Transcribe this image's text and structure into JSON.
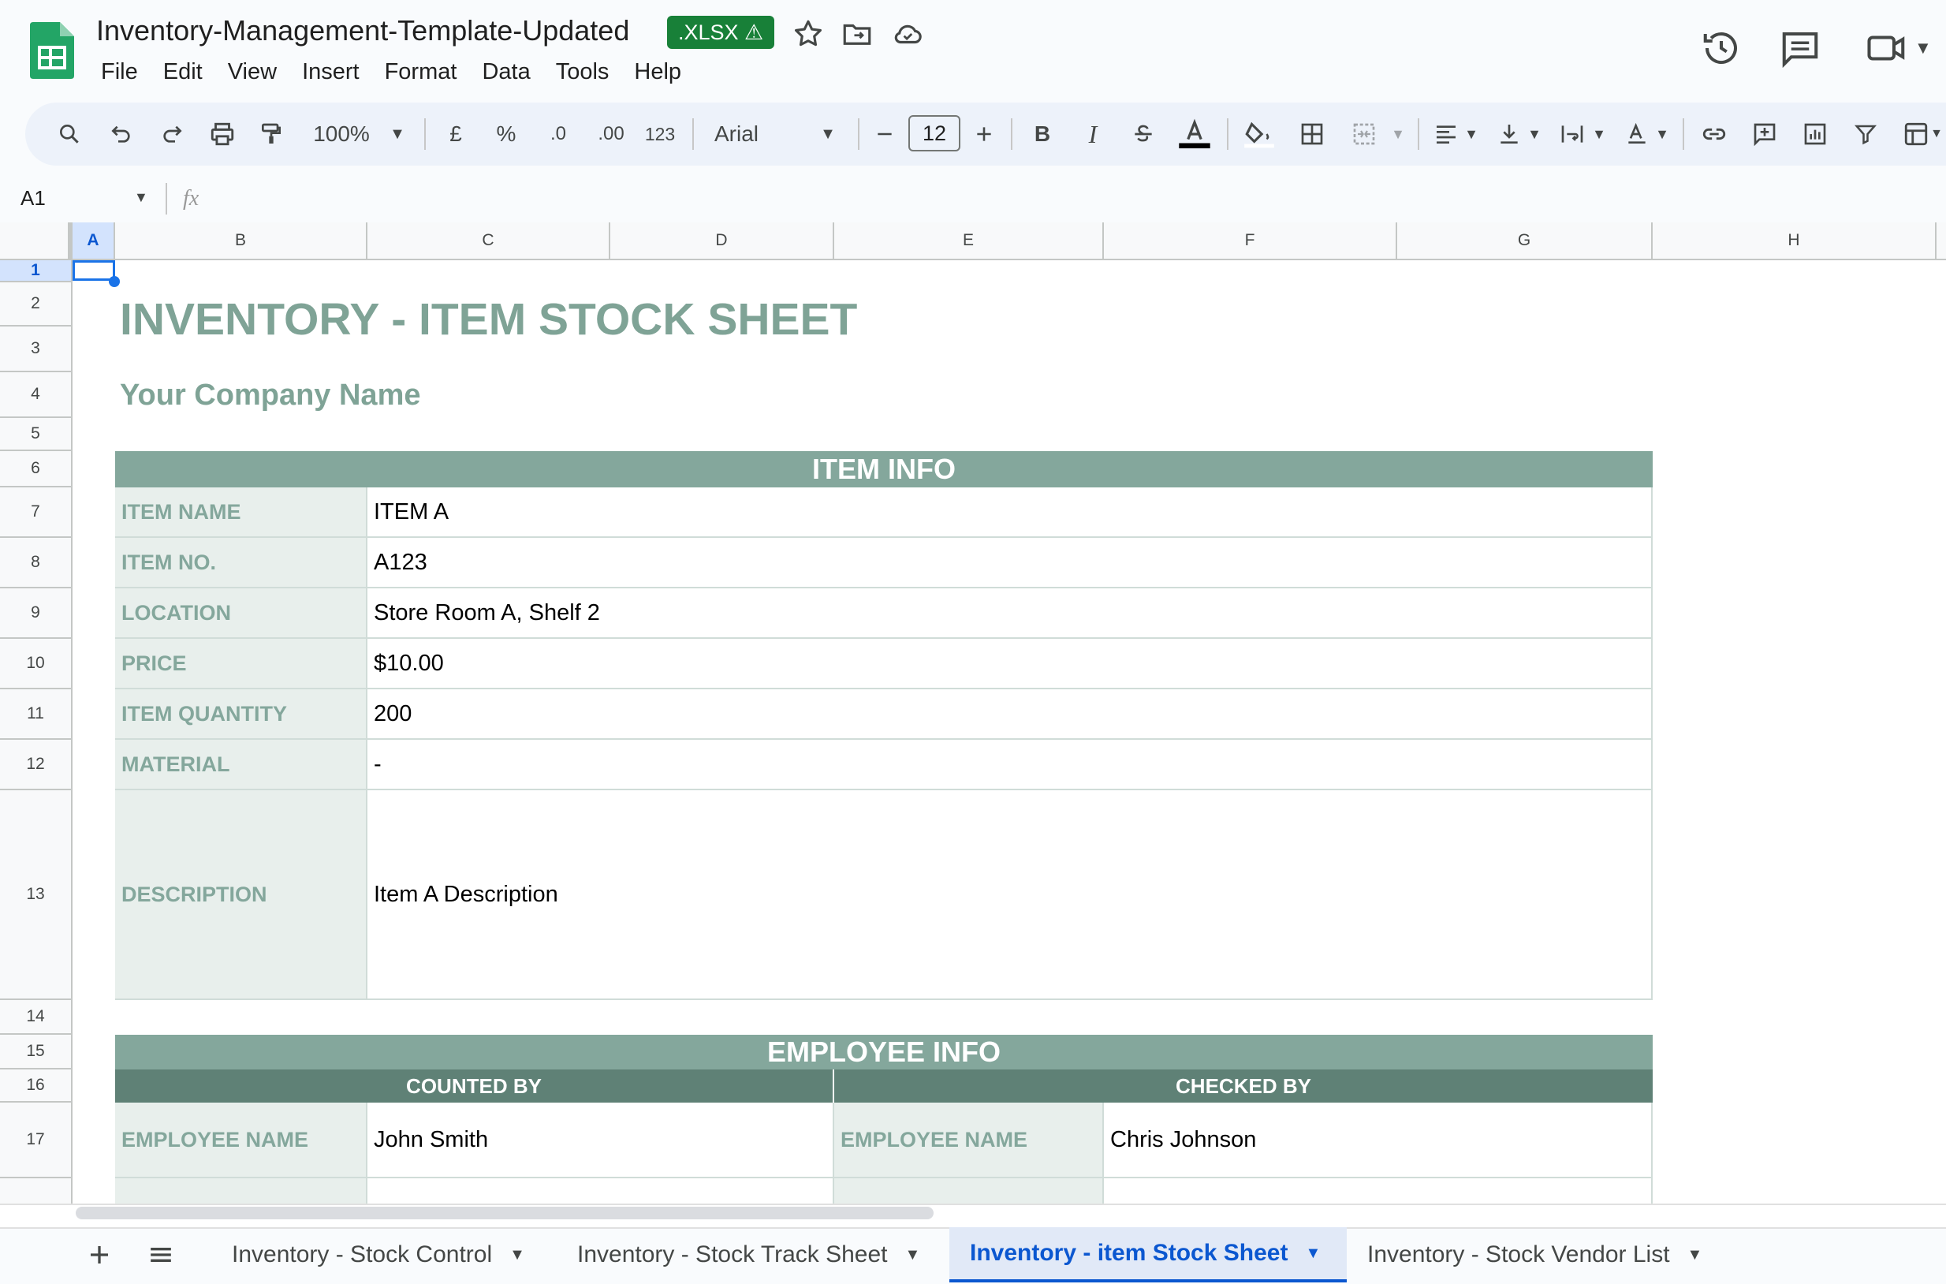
{
  "document": {
    "title": "Inventory-Management-Template-Updated",
    "badge": ".XLSX ⚠"
  },
  "menu": [
    "File",
    "Edit",
    "View",
    "Insert",
    "Format",
    "Data",
    "Tools",
    "Help"
  ],
  "toolbar": {
    "zoom": "100%",
    "currency": "£",
    "percent": "%",
    "dec_decrease": ".0",
    "dec_increase": ".00",
    "number_format": "123",
    "font": "Arial",
    "font_size": "12",
    "bold": "B",
    "italic": "I"
  },
  "formula_bar": {
    "cell_ref": "A1",
    "fx": "fx"
  },
  "columns": [
    "A",
    "B",
    "C",
    "D",
    "E",
    "F",
    "G",
    "H"
  ],
  "rows": [
    "1",
    "2",
    "3",
    "4",
    "5",
    "6",
    "7",
    "8",
    "9",
    "10",
    "11",
    "12",
    "13",
    "14",
    "15",
    "16",
    "17"
  ],
  "sheet": {
    "title": "INVENTORY - ITEM STOCK SHEET",
    "company": "Your Company Name",
    "item_info": {
      "header": "ITEM INFO",
      "fields": [
        {
          "label": "ITEM NAME",
          "value": "ITEM A"
        },
        {
          "label": "ITEM NO.",
          "value": "A123"
        },
        {
          "label": "LOCATION",
          "value": "Store Room A, Shelf 2"
        },
        {
          "label": "PRICE",
          "value": "$10.00"
        },
        {
          "label": "ITEM QUANTITY",
          "value": "200"
        },
        {
          "label": "MATERIAL",
          "value": "-"
        },
        {
          "label": "DESCRIPTION",
          "value": "Item A Description"
        }
      ]
    },
    "employee_info": {
      "header": "EMPLOYEE INFO",
      "counted_by": "COUNTED BY",
      "checked_by": "CHECKED BY",
      "counted_label": "EMPLOYEE NAME",
      "counted_name": "John Smith",
      "checked_label": "EMPLOYEE NAME",
      "checked_name": "Chris Johnson"
    }
  },
  "tabs": [
    {
      "label": "Inventory - Stock Control",
      "active": false
    },
    {
      "label": "Inventory - Stock Track Sheet",
      "active": false
    },
    {
      "label": "Inventory - item Stock Sheet",
      "active": true
    },
    {
      "label": "Inventory - Stock Vendor List",
      "active": false
    }
  ],
  "colors": {
    "accent": "#84a79c",
    "accent_dark": "#5f8176",
    "label_bg": "#e8efec",
    "active_tab": "#0b57d0",
    "badge": "#188038"
  }
}
